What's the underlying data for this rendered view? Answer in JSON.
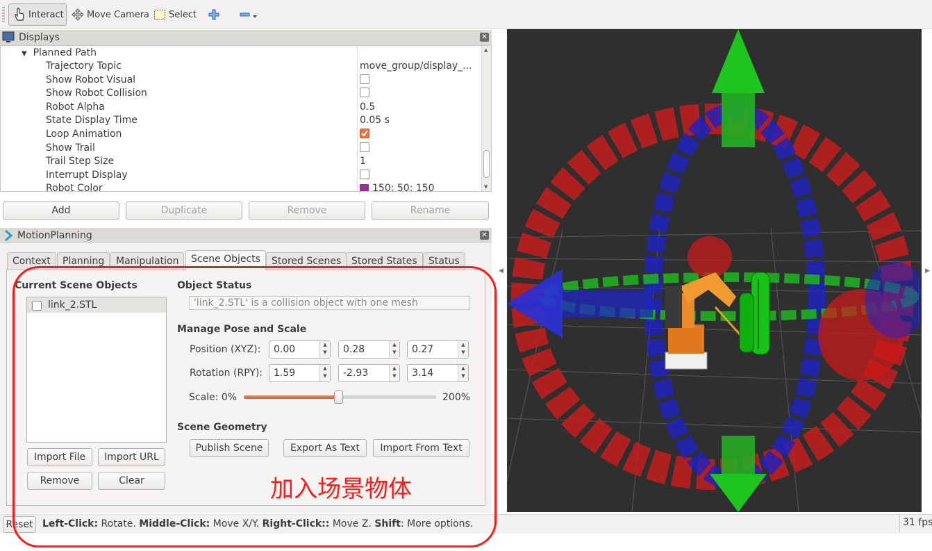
{
  "toolbar": {
    "interact": "Interact",
    "move_camera": "Move Camera",
    "select": "Select"
  },
  "displays": {
    "title": "Displays",
    "group": "Planned Path",
    "properties": [
      {
        "name": "Trajectory Topic",
        "value": "move_group/display_...",
        "type": "text"
      },
      {
        "name": "Show Robot Visual",
        "value": false,
        "type": "checkbox"
      },
      {
        "name": "Show Robot Collision",
        "value": false,
        "type": "checkbox"
      },
      {
        "name": "Robot Alpha",
        "value": "0.5",
        "type": "text"
      },
      {
        "name": "State Display Time",
        "value": "0.05 s",
        "type": "text"
      },
      {
        "name": "Loop Animation",
        "value": true,
        "type": "checkbox"
      },
      {
        "name": "Show Trail",
        "value": false,
        "type": "checkbox"
      },
      {
        "name": "Trail Step Size",
        "value": "1",
        "type": "text"
      },
      {
        "name": "Interrupt Display",
        "value": false,
        "type": "checkbox"
      },
      {
        "name": "Robot Color",
        "value": "150; 50; 150",
        "type": "color",
        "swatch": "#963296"
      }
    ],
    "buttons": {
      "add": "Add",
      "duplicate": "Duplicate",
      "remove": "Remove",
      "rename": "Rename"
    }
  },
  "motion_planning": {
    "title": "MotionPlanning",
    "tabs": [
      "Context",
      "Planning",
      "Manipulation",
      "Scene Objects",
      "Stored Scenes",
      "Stored States",
      "Status"
    ],
    "active_tab": "Scene Objects",
    "scene_objects": {
      "list_title": "Current Scene Objects",
      "items": [
        "link_2.STL"
      ],
      "import_file": "Import File",
      "import_url": "Import URL",
      "remove": "Remove",
      "clear": "Clear",
      "object_status_title": "Object Status",
      "object_status_text": "'link_2.STL' is a collision object with one mesh",
      "manage_title": "Manage Pose and Scale",
      "position_label": "Position (XYZ):",
      "position": [
        "0.00",
        "0.28",
        "0.27"
      ],
      "rotation_label": "Rotation (RPY):",
      "rotation": [
        "1.59",
        "-2.93",
        "3.14"
      ],
      "scale_label": "Scale:",
      "scale_min": "0%",
      "scale_max": "200%",
      "scale_fraction": 0.49,
      "geometry_title": "Scene Geometry",
      "publish_scene": "Publish Scene",
      "export_text": "Export As Text",
      "import_text": "Import From Text"
    }
  },
  "annotation": {
    "text": "加入场景物体",
    "color": "#ff1a1a"
  },
  "statusbar": {
    "reset": "Reset",
    "left_click_key": "Left-Click:",
    "left_click_val": " Rotate. ",
    "middle_click_key": "Middle-Click:",
    "middle_click_val": " Move X/Y. ",
    "right_click_key": "Right-Click::",
    "right_click_val": " Move Z. ",
    "shift_key": "Shift",
    "shift_val": ": More options.",
    "fps": "31 fps"
  },
  "colors": {
    "accent": "#e9723d",
    "viewport_bg": "#2f2f2f",
    "ring_red": "#c41c1c",
    "ring_green": "#1fbf1f",
    "ring_blue": "#1b22c8"
  }
}
